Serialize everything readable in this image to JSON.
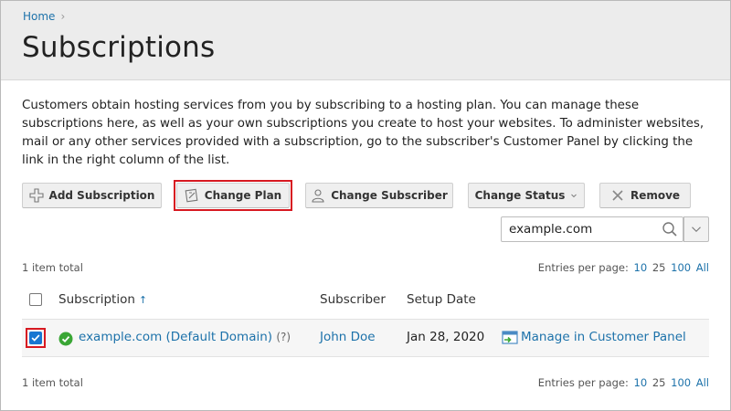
{
  "breadcrumb": {
    "home": "Home",
    "sep": "›"
  },
  "page": {
    "title": "Subscriptions",
    "description": "Customers obtain hosting services from you by subscribing to a hosting plan. You can manage these subscriptions here, as well as your own subscriptions you create to host your websites. To administer websites, mail or any other services provided with a subscription, go to the subscriber's Customer Panel by clicking the link in the right column of the list."
  },
  "toolbar": {
    "add": "Add Subscription",
    "change_plan": "Change Plan",
    "change_subscriber": "Change Subscriber",
    "change_status": "Change Status",
    "remove": "Remove"
  },
  "search": {
    "value": "example.com"
  },
  "list": {
    "total_top": "1 item total",
    "total_bottom": "1 item total",
    "entries_label": "Entries per page:",
    "page_sizes": [
      "10",
      "25",
      "100",
      "All"
    ],
    "columns": {
      "subscription": "Subscription",
      "subscriber": "Subscriber",
      "setup_date": "Setup Date"
    },
    "rows": [
      {
        "subscription": "example.com (Default Domain)",
        "help": "(?)",
        "subscriber": "John Doe",
        "setup_date": "Jan 28, 2020",
        "manage": "Manage in Customer Panel"
      }
    ]
  },
  "colors": {
    "accent": "#1d72aa",
    "highlight": "#d71921",
    "checkbox": "#1876d1",
    "ok": "#3aa635"
  }
}
